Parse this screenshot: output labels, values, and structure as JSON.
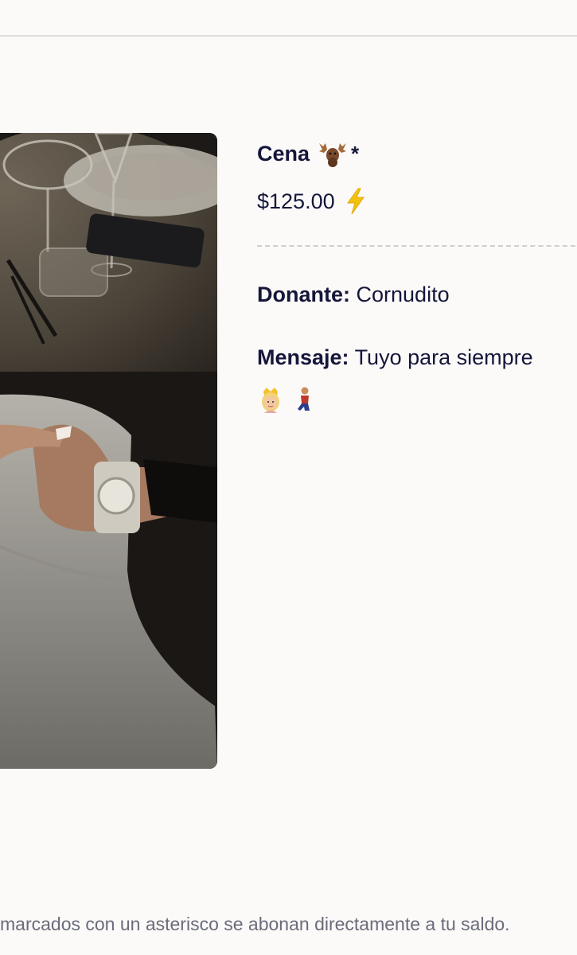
{
  "item": {
    "title": "Cena",
    "title_icon": "moose-icon",
    "asterisk": "*",
    "price": "$125.00",
    "price_icon": "lightning-bolt-icon"
  },
  "donor": {
    "label": "Donante:",
    "value": "Cornudito"
  },
  "message": {
    "label": "Mensaje:",
    "value": "Tuyo para siempre",
    "emojis": [
      "princess-emoji",
      "kneeling-man-emoji"
    ]
  },
  "footer": {
    "note": "marcados con un asterisco se abonan directamente a tu saldo."
  },
  "colors": {
    "background": "#fbfaf9",
    "text": "#15163a",
    "muted": "#6b6b7a",
    "divider": "#cfcfcf"
  }
}
